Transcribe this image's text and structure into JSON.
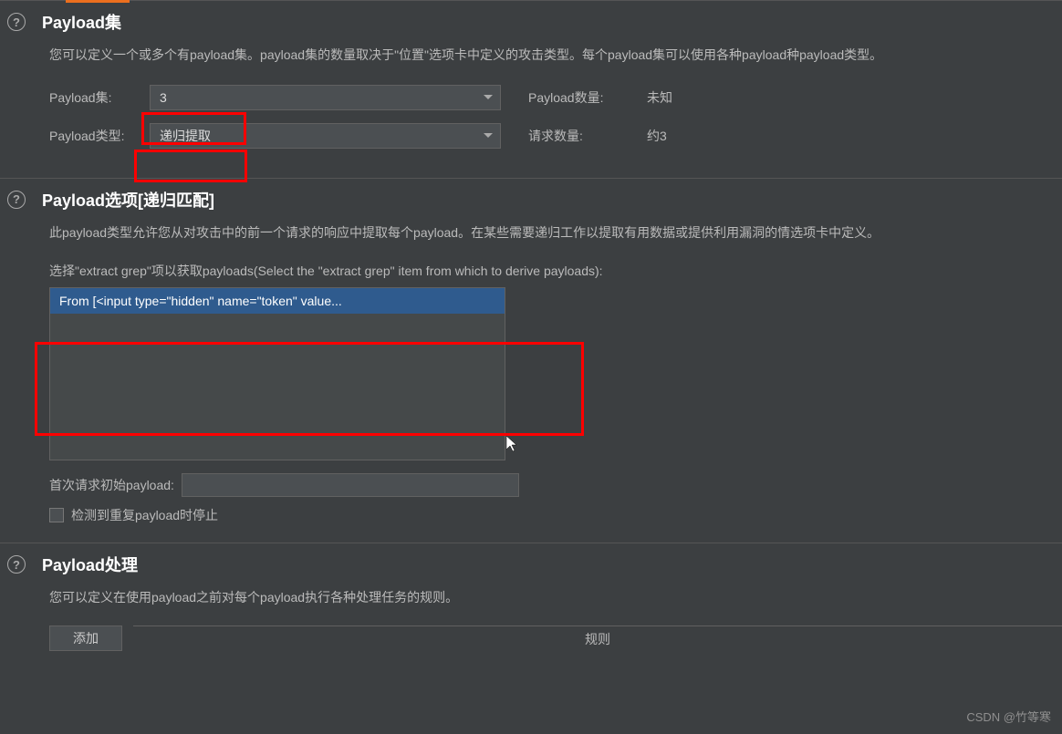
{
  "section1": {
    "title": "Payload集",
    "desc": "您可以定义一个或多个有payload集。payload集的数量取决于\"位置\"选项卡中定义的攻击类型。每个payload集可以使用各种payload种payload类型。",
    "row1_label": "Payload集:",
    "row1_value": "3",
    "row2_label": "Payload类型:",
    "row2_value": "递归提取",
    "count_label": "Payload数量:",
    "count_value": "未知",
    "req_label": "请求数量:",
    "req_value": "约3"
  },
  "section2": {
    "title": "Payload选项[递归匹配]",
    "desc": "此payload类型允许您从对攻击中的前一个请求的响应中提取每个payload。在某些需要递归工作以提取有用数据或提供利用漏洞的情选项卡中定义。",
    "select_label": "选择\"extract grep\"项以获取payloads(Select the \"extract grep\" item from which to derive payloads):",
    "list_item": "From [<input type=\"hidden\" name=\"token\" value...",
    "initial_label": "首次请求初始payload:",
    "initial_value": "",
    "stop_label": "检测到重复payload时停止"
  },
  "section3": {
    "title": "Payload处理",
    "desc": "您可以定义在使用payload之前对每个payload执行各种处理任务的规则。",
    "btn_add": "添加",
    "rule_header": "规则"
  },
  "watermark": "CSDN @竹等寒"
}
